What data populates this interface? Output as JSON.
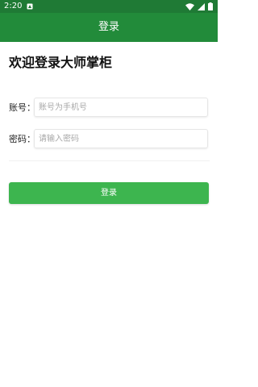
{
  "status_bar": {
    "time": "2:20",
    "icons": [
      "notification-icon",
      "wifi-icon",
      "signal-icon",
      "battery-icon"
    ],
    "background": "#1f7a35"
  },
  "app_bar": {
    "title": "登录",
    "background": "#228b3a"
  },
  "login": {
    "heading": "欢迎登录大师掌柜",
    "account": {
      "label": "账号：",
      "placeholder": "账号为手机号",
      "value": ""
    },
    "password": {
      "label": "密码：",
      "placeholder": "请输入密码",
      "value": ""
    },
    "submit_label": "登录",
    "button_color": "#3db54f"
  }
}
